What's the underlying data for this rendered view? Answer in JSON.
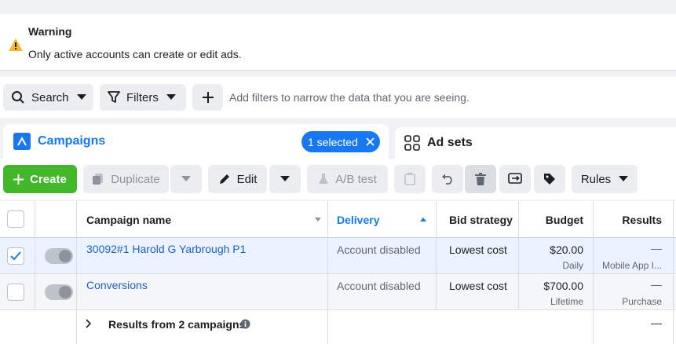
{
  "warning": {
    "title": "Warning",
    "message": "Only active accounts can create or edit ads."
  },
  "filters": {
    "search_label": "Search",
    "filters_label": "Filters",
    "hint": "Add filters to narrow the data that you are seeing."
  },
  "tabs": {
    "campaigns": "Campaigns",
    "selected": "1 selected",
    "adsets": "Ad sets"
  },
  "toolbar": {
    "create": "Create",
    "duplicate": "Duplicate",
    "edit": "Edit",
    "ab_test": "A/B test",
    "rules": "Rules"
  },
  "table": {
    "headers": {
      "name": "Campaign name",
      "delivery": "Delivery",
      "bid": "Bid strategy",
      "budget": "Budget",
      "results": "Results"
    },
    "rows": [
      {
        "name": "30092#1 Harold G Yarbrough P1",
        "delivery": "Account disabled",
        "bid": "Lowest cost",
        "budget": "$20.00",
        "budget_type": "Daily",
        "results": "—",
        "results_sub": "Mobile App I...",
        "selected": true
      },
      {
        "name": "Conversions",
        "delivery": "Account disabled",
        "bid": "Lowest cost",
        "budget": "$700.00",
        "budget_type": "Lifetime",
        "results": "—",
        "results_sub": "Purchase",
        "selected": false
      }
    ],
    "summary": {
      "label": "Results from 2 campaigns",
      "results": "—"
    }
  },
  "colors": {
    "accent": "#1877f2",
    "create": "#42b72a",
    "link": "#1d5ec9"
  }
}
